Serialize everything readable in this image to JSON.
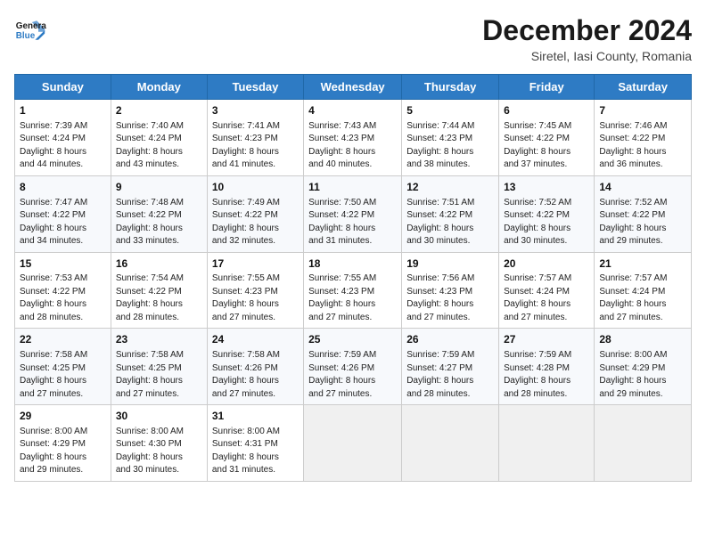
{
  "logo": {
    "line1": "General",
    "line2": "Blue"
  },
  "title": "December 2024",
  "subtitle": "Siretel, Iasi County, Romania",
  "days_header": [
    "Sunday",
    "Monday",
    "Tuesday",
    "Wednesday",
    "Thursday",
    "Friday",
    "Saturday"
  ],
  "weeks": [
    [
      {
        "day": "1",
        "info": "Sunrise: 7:39 AM\nSunset: 4:24 PM\nDaylight: 8 hours\nand 44 minutes."
      },
      {
        "day": "2",
        "info": "Sunrise: 7:40 AM\nSunset: 4:24 PM\nDaylight: 8 hours\nand 43 minutes."
      },
      {
        "day": "3",
        "info": "Sunrise: 7:41 AM\nSunset: 4:23 PM\nDaylight: 8 hours\nand 41 minutes."
      },
      {
        "day": "4",
        "info": "Sunrise: 7:43 AM\nSunset: 4:23 PM\nDaylight: 8 hours\nand 40 minutes."
      },
      {
        "day": "5",
        "info": "Sunrise: 7:44 AM\nSunset: 4:23 PM\nDaylight: 8 hours\nand 38 minutes."
      },
      {
        "day": "6",
        "info": "Sunrise: 7:45 AM\nSunset: 4:22 PM\nDaylight: 8 hours\nand 37 minutes."
      },
      {
        "day": "7",
        "info": "Sunrise: 7:46 AM\nSunset: 4:22 PM\nDaylight: 8 hours\nand 36 minutes."
      }
    ],
    [
      {
        "day": "8",
        "info": "Sunrise: 7:47 AM\nSunset: 4:22 PM\nDaylight: 8 hours\nand 34 minutes."
      },
      {
        "day": "9",
        "info": "Sunrise: 7:48 AM\nSunset: 4:22 PM\nDaylight: 8 hours\nand 33 minutes."
      },
      {
        "day": "10",
        "info": "Sunrise: 7:49 AM\nSunset: 4:22 PM\nDaylight: 8 hours\nand 32 minutes."
      },
      {
        "day": "11",
        "info": "Sunrise: 7:50 AM\nSunset: 4:22 PM\nDaylight: 8 hours\nand 31 minutes."
      },
      {
        "day": "12",
        "info": "Sunrise: 7:51 AM\nSunset: 4:22 PM\nDaylight: 8 hours\nand 30 minutes."
      },
      {
        "day": "13",
        "info": "Sunrise: 7:52 AM\nSunset: 4:22 PM\nDaylight: 8 hours\nand 30 minutes."
      },
      {
        "day": "14",
        "info": "Sunrise: 7:52 AM\nSunset: 4:22 PM\nDaylight: 8 hours\nand 29 minutes."
      }
    ],
    [
      {
        "day": "15",
        "info": "Sunrise: 7:53 AM\nSunset: 4:22 PM\nDaylight: 8 hours\nand 28 minutes."
      },
      {
        "day": "16",
        "info": "Sunrise: 7:54 AM\nSunset: 4:22 PM\nDaylight: 8 hours\nand 28 minutes."
      },
      {
        "day": "17",
        "info": "Sunrise: 7:55 AM\nSunset: 4:23 PM\nDaylight: 8 hours\nand 27 minutes."
      },
      {
        "day": "18",
        "info": "Sunrise: 7:55 AM\nSunset: 4:23 PM\nDaylight: 8 hours\nand 27 minutes."
      },
      {
        "day": "19",
        "info": "Sunrise: 7:56 AM\nSunset: 4:23 PM\nDaylight: 8 hours\nand 27 minutes."
      },
      {
        "day": "20",
        "info": "Sunrise: 7:57 AM\nSunset: 4:24 PM\nDaylight: 8 hours\nand 27 minutes."
      },
      {
        "day": "21",
        "info": "Sunrise: 7:57 AM\nSunset: 4:24 PM\nDaylight: 8 hours\nand 27 minutes."
      }
    ],
    [
      {
        "day": "22",
        "info": "Sunrise: 7:58 AM\nSunset: 4:25 PM\nDaylight: 8 hours\nand 27 minutes."
      },
      {
        "day": "23",
        "info": "Sunrise: 7:58 AM\nSunset: 4:25 PM\nDaylight: 8 hours\nand 27 minutes."
      },
      {
        "day": "24",
        "info": "Sunrise: 7:58 AM\nSunset: 4:26 PM\nDaylight: 8 hours\nand 27 minutes."
      },
      {
        "day": "25",
        "info": "Sunrise: 7:59 AM\nSunset: 4:26 PM\nDaylight: 8 hours\nand 27 minutes."
      },
      {
        "day": "26",
        "info": "Sunrise: 7:59 AM\nSunset: 4:27 PM\nDaylight: 8 hours\nand 28 minutes."
      },
      {
        "day": "27",
        "info": "Sunrise: 7:59 AM\nSunset: 4:28 PM\nDaylight: 8 hours\nand 28 minutes."
      },
      {
        "day": "28",
        "info": "Sunrise: 8:00 AM\nSunset: 4:29 PM\nDaylight: 8 hours\nand 29 minutes."
      }
    ],
    [
      {
        "day": "29",
        "info": "Sunrise: 8:00 AM\nSunset: 4:29 PM\nDaylight: 8 hours\nand 29 minutes."
      },
      {
        "day": "30",
        "info": "Sunrise: 8:00 AM\nSunset: 4:30 PM\nDaylight: 8 hours\nand 30 minutes."
      },
      {
        "day": "31",
        "info": "Sunrise: 8:00 AM\nSunset: 4:31 PM\nDaylight: 8 hours\nand 31 minutes."
      },
      {
        "day": "",
        "info": ""
      },
      {
        "day": "",
        "info": ""
      },
      {
        "day": "",
        "info": ""
      },
      {
        "day": "",
        "info": ""
      }
    ]
  ]
}
